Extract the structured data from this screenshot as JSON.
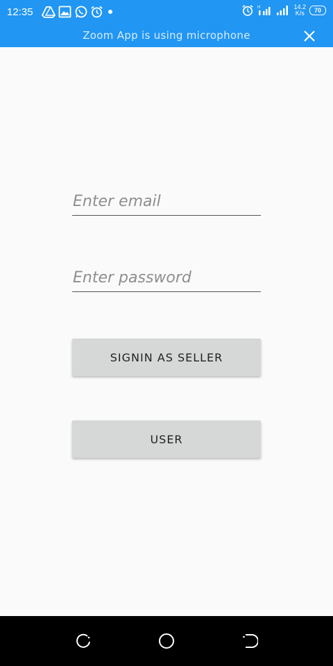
{
  "status_bar": {
    "time": "12:35",
    "net_speed_value": "14.2",
    "net_speed_unit": "K/s",
    "battery": "70",
    "notification_icons": [
      "drive-icon",
      "gallery-icon",
      "whatsapp-icon",
      "alarm-icon",
      "dot-icon"
    ],
    "system_icons": [
      "alarm-icon",
      "signal-icon",
      "signal-icon"
    ]
  },
  "banner": {
    "text": "Zoom App is using microphone"
  },
  "form": {
    "email_placeholder": "Enter email",
    "password_placeholder": "Enter password",
    "seller_button_label": "SIGNIN AS SELLER",
    "user_button_label": "USER"
  },
  "nav": {
    "icons": [
      "recent-apps-icon",
      "home-icon",
      "back-icon"
    ]
  },
  "colors": {
    "status_bar": "#2196f3",
    "background": "#fafafa",
    "button": "#d6d7d7",
    "nav_bar": "#000000"
  }
}
